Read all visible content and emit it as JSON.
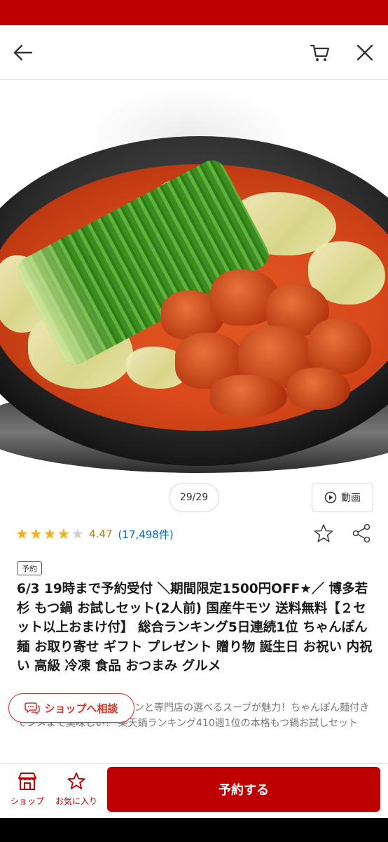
{
  "colors": {
    "brand": "#bf0000",
    "star": "#f2b01e",
    "link": "#0066cc"
  },
  "nav": {
    "back_icon": "arrow-left-icon",
    "cart_icon": "cart-icon",
    "close_icon": "close-icon"
  },
  "gallery": {
    "counter": "29/29",
    "video_label": "動画"
  },
  "rating": {
    "stars": [
      "full",
      "full",
      "full",
      "full",
      "empty"
    ],
    "value": "4.47",
    "count": "(17,498件)"
  },
  "product": {
    "tag": "予約",
    "title": "6/3 19時まで予約受付 ＼期間限定1500円OFF★／ 博多若杉 もつ鍋 お試しセット(2人前) 国産牛モツ 送料無料【２セット以上おまけ付】 総合ランキング5日連続1位 ちゃんぽん麺 お取り寄せ ギフト プレゼント 贈り物 誕生日 お祝い 内祝い 高級 冷凍 食品 おつまみ グルメ",
    "description": "販売　ぷるるん新鮮ホルモンと専門店の選べるスープが魅力！ちゃんぽん麺付きでシメまで美味しい！ 楽天鍋ランキング410週1位の本格もつ鍋お試しセット"
  },
  "consult": {
    "label": "ショップへ相談"
  },
  "bottom": {
    "shop_label": "ショップ",
    "fav_label": "お気に入り",
    "reserve_label": "予約する"
  }
}
